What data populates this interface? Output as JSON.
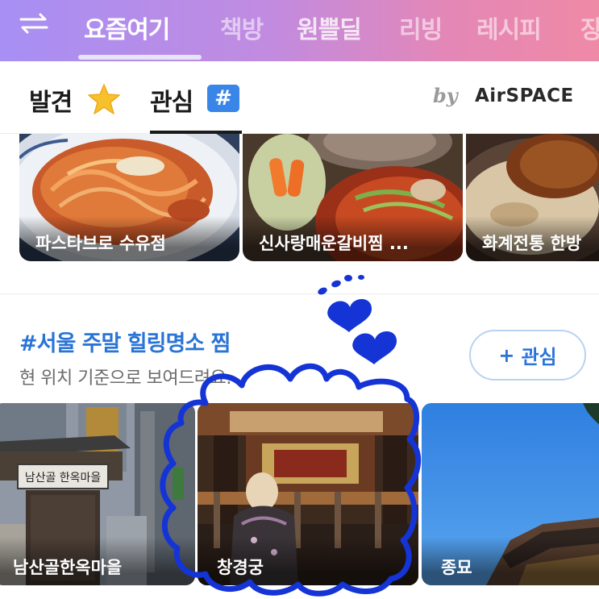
{
  "top_nav": {
    "tabs": [
      {
        "label": "요즘여기"
      },
      {
        "label": "책방"
      },
      {
        "label": "원쁠딜"
      },
      {
        "label": "리빙"
      },
      {
        "label": "레시피"
      },
      {
        "label": "장"
      }
    ],
    "active_index": 0
  },
  "sub_tabs": {
    "discover_label": "발견",
    "interest_label": "관심",
    "hash_symbol": "#",
    "by_label": "by",
    "brand": "AirSPACE"
  },
  "food_cards": [
    {
      "label": "파스타브로 수유점"
    },
    {
      "label": "신사랑매운갈비찜 ..."
    },
    {
      "label": "화계전통 한방"
    }
  ],
  "section": {
    "title": "#서울 주말 힐링명소 찜",
    "subtitle": "현 위치 기준으로 보여드려요.",
    "follow_plus": "+",
    "follow_label": "관심"
  },
  "place_cards": [
    {
      "label": "남산골한옥마을",
      "sign_text": "남산골 한옥마을"
    },
    {
      "label": "창경궁"
    },
    {
      "label": "종묘"
    }
  ],
  "colors": {
    "accent_blue": "#2a74d6",
    "doodle_blue": "#1534d6"
  }
}
